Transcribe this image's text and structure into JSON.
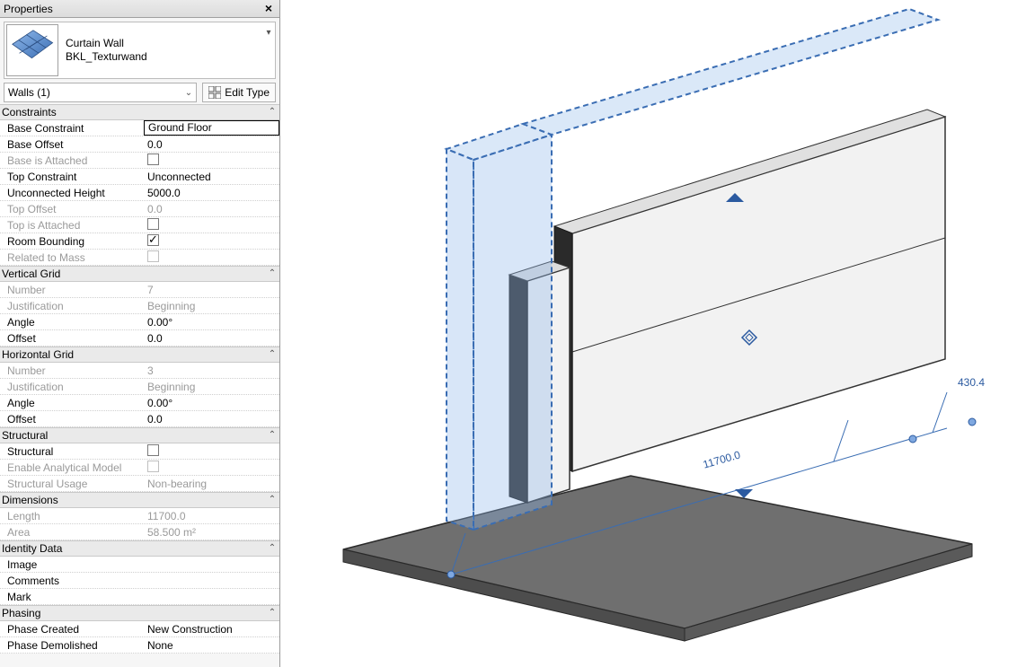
{
  "panel": {
    "title": "Properties",
    "family": "Curtain Wall",
    "type": "BKL_Texturwand",
    "instance_filter": "Walls (1)",
    "edit_type": "Edit Type"
  },
  "groups": {
    "constraints": {
      "title": "Constraints",
      "base_constraint": {
        "label": "Base Constraint",
        "value": "Ground Floor"
      },
      "base_offset": {
        "label": "Base Offset",
        "value": "0.0"
      },
      "base_attached": {
        "label": "Base is Attached"
      },
      "top_constraint": {
        "label": "Top Constraint",
        "value": "Unconnected"
      },
      "unc_height": {
        "label": "Unconnected Height",
        "value": "5000.0"
      },
      "top_offset": {
        "label": "Top Offset",
        "value": "0.0"
      },
      "top_attached": {
        "label": "Top is Attached"
      },
      "room_bounding": {
        "label": "Room Bounding"
      },
      "related_mass": {
        "label": "Related to Mass"
      }
    },
    "vgrid": {
      "title": "Vertical Grid",
      "number": {
        "label": "Number",
        "value": "7"
      },
      "just": {
        "label": "Justification",
        "value": "Beginning"
      },
      "angle": {
        "label": "Angle",
        "value": "0.00°"
      },
      "offset": {
        "label": "Offset",
        "value": "0.0"
      }
    },
    "hgrid": {
      "title": "Horizontal Grid",
      "number": {
        "label": "Number",
        "value": "3"
      },
      "just": {
        "label": "Justification",
        "value": "Beginning"
      },
      "angle": {
        "label": "Angle",
        "value": "0.00°"
      },
      "offset": {
        "label": "Offset",
        "value": "0.0"
      }
    },
    "structural": {
      "title": "Structural",
      "structural": {
        "label": "Structural"
      },
      "enable_am": {
        "label": "Enable Analytical Model"
      },
      "usage": {
        "label": "Structural Usage",
        "value": "Non-bearing"
      }
    },
    "dimensions": {
      "title": "Dimensions",
      "length": {
        "label": "Length",
        "value": "11700.0"
      },
      "area": {
        "label": "Area",
        "value": "58.500 m²"
      }
    },
    "identity": {
      "title": "Identity Data",
      "image": {
        "label": "Image",
        "value": ""
      },
      "comments": {
        "label": "Comments",
        "value": ""
      },
      "mark": {
        "label": "Mark",
        "value": ""
      }
    },
    "phasing": {
      "title": "Phasing",
      "created": {
        "label": "Phase Created",
        "value": "New Construction"
      },
      "demolished": {
        "label": "Phase Demolished",
        "value": "None"
      }
    }
  },
  "view": {
    "dim1": "11700.0",
    "dim2": "430.4"
  }
}
